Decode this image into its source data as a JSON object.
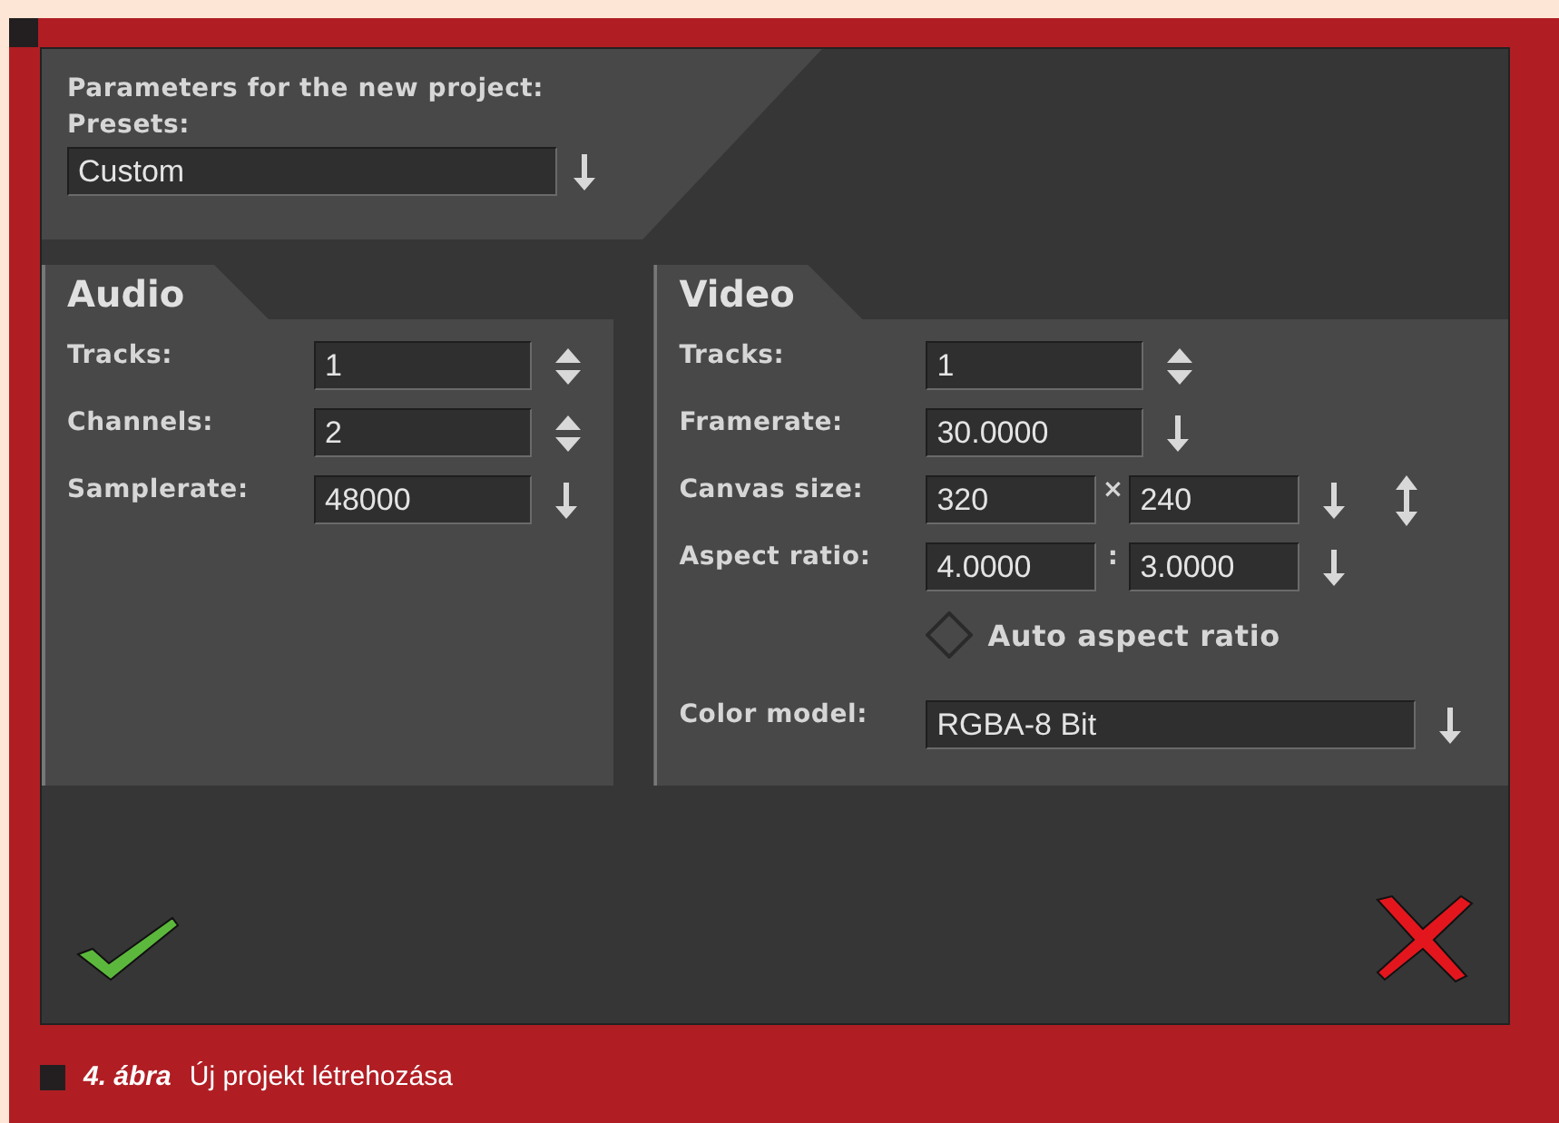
{
  "header": {
    "title": "Parameters for the new project:",
    "presets_label": "Presets:",
    "preset": "Custom"
  },
  "audio": {
    "title": "Audio",
    "rows": [
      {
        "label": "Tracks:",
        "kind": "spin",
        "fields": [
          "1"
        ]
      },
      {
        "label": "Channels:",
        "kind": "spin",
        "fields": [
          "2"
        ]
      },
      {
        "label": "Samplerate:",
        "kind": "menu",
        "fields": [
          "48000"
        ]
      }
    ]
  },
  "video": {
    "title": "Video",
    "rows": [
      {
        "label": "Tracks:",
        "kind": "spin",
        "fields": [
          "1"
        ]
      },
      {
        "label": "Framerate:",
        "kind": "menu",
        "fields": [
          "30.0000"
        ]
      },
      {
        "label": "Canvas size:",
        "kind": "menu_swap",
        "fields": [
          "320",
          "240"
        ],
        "separator": "×"
      },
      {
        "label": "Aspect ratio:",
        "kind": "menu",
        "fields": [
          "4.0000",
          "3.0000"
        ],
        "separator": ":"
      }
    ],
    "auto_aspect": {
      "label": "Auto aspect ratio",
      "checked": false
    },
    "color_model": {
      "label": "Color model:",
      "value": "RGBA-8 Bit"
    }
  },
  "caption": {
    "number": "4. ábra",
    "text": "Új projekt létrehozása"
  }
}
